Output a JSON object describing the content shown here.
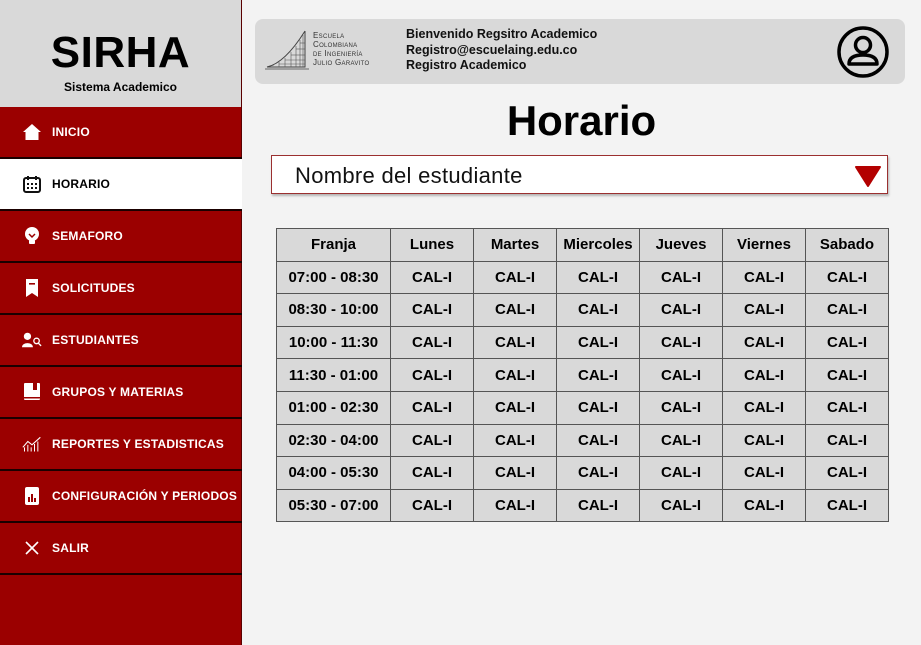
{
  "brand": {
    "title": "SIRHA",
    "subtitle": "Sistema Academico"
  },
  "nav": [
    {
      "label": "INICIO",
      "icon": "home-icon"
    },
    {
      "label": "HORARIO",
      "icon": "calendar-icon",
      "active": true
    },
    {
      "label": "SEMAFORO",
      "icon": "lightbulb-icon"
    },
    {
      "label": "SOLICITUDES",
      "icon": "bookmark-icon"
    },
    {
      "label": "ESTUDIANTES",
      "icon": "user-search-icon"
    },
    {
      "label": "GRUPOS Y MATERIAS",
      "icon": "book-icon"
    },
    {
      "label": "REPORTES  Y ESTADISTICAS",
      "icon": "chart-icon"
    },
    {
      "label": "CONFIGURACIÓN Y PERIODOS",
      "icon": "report-doc-icon"
    },
    {
      "label": "SALIR",
      "icon": "close-icon"
    }
  ],
  "header": {
    "logo_lines": [
      "Escuela",
      "Colombiana",
      "de Ingeniería",
      "Julio Garavito"
    ],
    "welcome": "Bienvenido Regsitro Academico",
    "email": "Registro@escuelaing.edu.co",
    "role": "Registro Academico"
  },
  "main": {
    "title": "Horario",
    "select_value": "Nombre del estudiante"
  },
  "schedule": {
    "columns": [
      "Franja",
      "Lunes",
      "Martes",
      "Miercoles",
      "Jueves",
      "Viernes",
      "Sabado"
    ],
    "rows": [
      {
        "franja": "07:00 - 08:30",
        "cells": [
          "CAL-I",
          "CAL-I",
          "CAL-I",
          "CAL-I",
          "CAL-I",
          "CAL-I"
        ]
      },
      {
        "franja": "08:30 - 10:00",
        "cells": [
          "CAL-I",
          "CAL-I",
          "CAL-I",
          "CAL-I",
          "CAL-I",
          "CAL-I"
        ]
      },
      {
        "franja": "10:00 - 11:30",
        "cells": [
          "CAL-I",
          "CAL-I",
          "CAL-I",
          "CAL-I",
          "CAL-I",
          "CAL-I"
        ]
      },
      {
        "franja": "11:30 - 01:00",
        "cells": [
          "CAL-I",
          "CAL-I",
          "CAL-I",
          "CAL-I",
          "CAL-I",
          "CAL-I"
        ]
      },
      {
        "franja": "01:00 - 02:30",
        "cells": [
          "CAL-I",
          "CAL-I",
          "CAL-I",
          "CAL-I",
          "CAL-I",
          "CAL-I"
        ]
      },
      {
        "franja": "02:30 - 04:00",
        "cells": [
          "CAL-I",
          "CAL-I",
          "CAL-I",
          "CAL-I",
          "CAL-I",
          "CAL-I"
        ]
      },
      {
        "franja": "04:00 - 05:30",
        "cells": [
          "CAL-I",
          "CAL-I",
          "CAL-I",
          "CAL-I",
          "CAL-I",
          "CAL-I"
        ]
      },
      {
        "franja": "05:30 - 07:00",
        "cells": [
          "CAL-I",
          "CAL-I",
          "CAL-I",
          "CAL-I",
          "CAL-I",
          "CAL-I"
        ]
      }
    ]
  },
  "colors": {
    "sidebar": "#9b0000",
    "accent": "#b30000",
    "panel": "#d9d9d9",
    "background": "#f3f3f3"
  }
}
